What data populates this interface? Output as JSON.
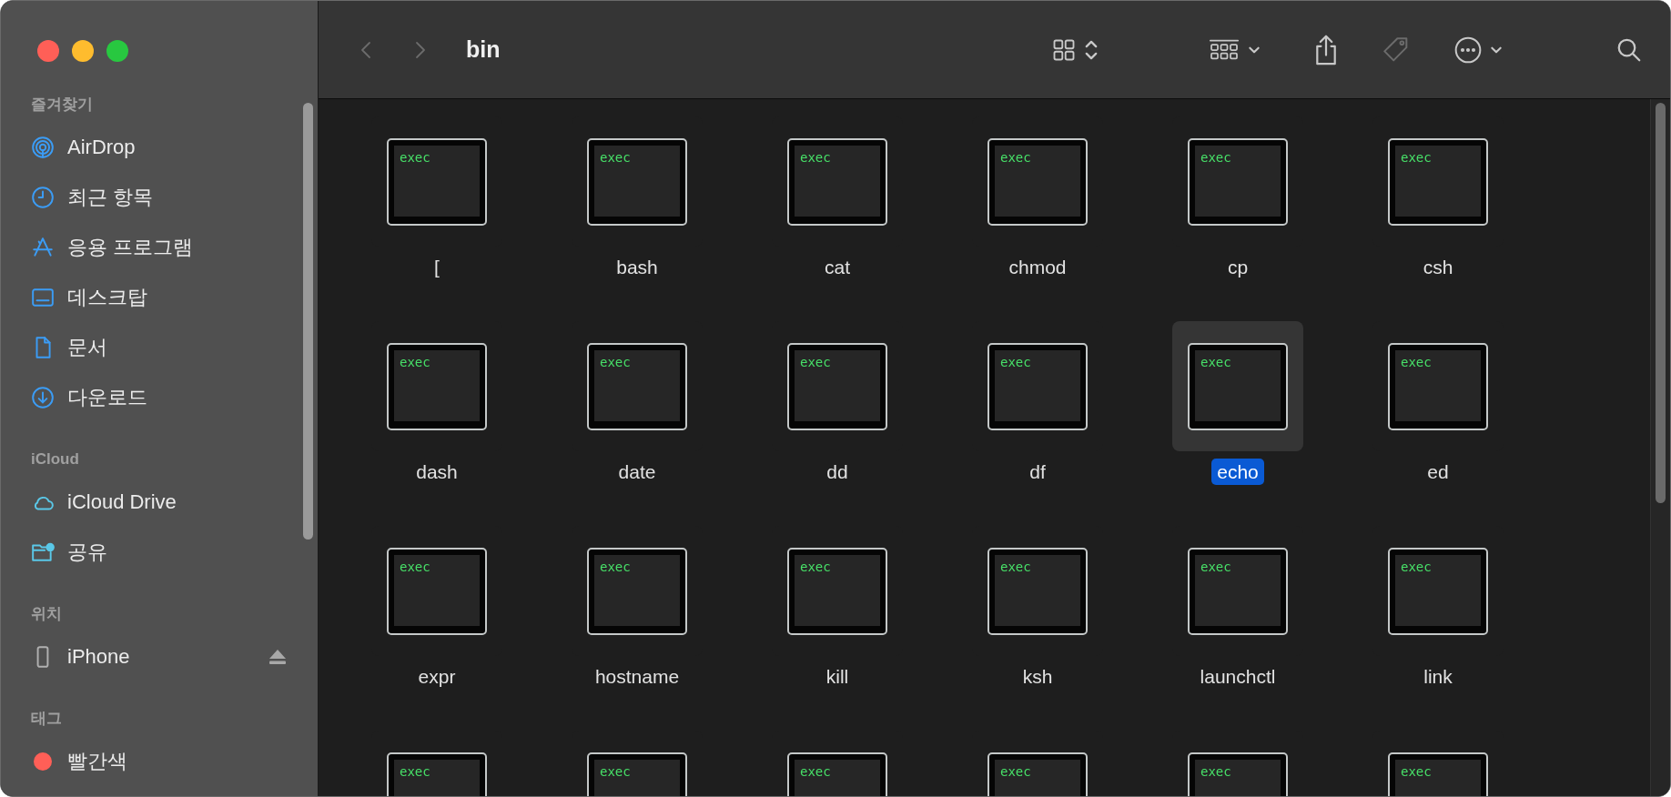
{
  "toolbar": {
    "navigation": [
      {
        "kind": "back",
        "disabled": true
      },
      {
        "kind": "forward",
        "disabled": true
      }
    ],
    "title": "bin",
    "tools": [
      {
        "kind": "view",
        "disabled": false
      },
      {
        "kind": "group",
        "disabled": false
      },
      {
        "kind": "share",
        "disabled": false
      },
      {
        "kind": "tags",
        "disabled": true
      },
      {
        "kind": "more",
        "disabled": false
      },
      {
        "kind": "search",
        "disabled": false
      }
    ]
  },
  "sidebar": {
    "sections": [
      {
        "title": "즐겨찾기",
        "items": [
          {
            "label": "AirDrop",
            "kind": "airdrop"
          },
          {
            "label": "최근 항목",
            "kind": "recent"
          },
          {
            "label": "응용 프로그램",
            "kind": "apps"
          },
          {
            "label": "데스크탑",
            "kind": "desktop"
          },
          {
            "label": "문서",
            "kind": "document"
          },
          {
            "label": "다운로드",
            "kind": "download"
          }
        ]
      },
      {
        "title": "iCloud",
        "items": [
          {
            "label": "iCloud Drive",
            "kind": "cloud"
          },
          {
            "label": "공유",
            "kind": "shared"
          }
        ]
      },
      {
        "title": "위치",
        "items": [
          {
            "label": "iPhone",
            "kind": "phone",
            "eject": true
          }
        ]
      },
      {
        "title": "태그",
        "items": [
          {
            "label": "빨간색",
            "kind": "tag",
            "color": "#ff5f57"
          }
        ]
      }
    ]
  },
  "files": [
    {
      "name": "[",
      "badge": "exec",
      "selected": false
    },
    {
      "name": "bash",
      "badge": "exec",
      "selected": false
    },
    {
      "name": "cat",
      "badge": "exec",
      "selected": false
    },
    {
      "name": "chmod",
      "badge": "exec",
      "selected": false
    },
    {
      "name": "cp",
      "badge": "exec",
      "selected": false
    },
    {
      "name": "csh",
      "badge": "exec",
      "selected": false
    },
    {
      "name": "dash",
      "badge": "exec",
      "selected": false
    },
    {
      "name": "date",
      "badge": "exec",
      "selected": false
    },
    {
      "name": "dd",
      "badge": "exec",
      "selected": false
    },
    {
      "name": "df",
      "badge": "exec",
      "selected": false
    },
    {
      "name": "echo",
      "badge": "exec",
      "selected": true
    },
    {
      "name": "ed",
      "badge": "exec",
      "selected": false
    },
    {
      "name": "expr",
      "badge": "exec",
      "selected": false
    },
    {
      "name": "hostname",
      "badge": "exec",
      "selected": false
    },
    {
      "name": "kill",
      "badge": "exec",
      "selected": false
    },
    {
      "name": "ksh",
      "badge": "exec",
      "selected": false
    },
    {
      "name": "launchctl",
      "badge": "exec",
      "selected": false
    },
    {
      "name": "link",
      "badge": "exec",
      "selected": false
    },
    {
      "badge": "exec",
      "selected": false
    },
    {
      "badge": "exec",
      "selected": false
    },
    {
      "badge": "exec",
      "selected": false
    },
    {
      "badge": "exec",
      "selected": false
    },
    {
      "badge": "exec",
      "selected": false
    },
    {
      "badge": "exec",
      "selected": false
    }
  ]
}
